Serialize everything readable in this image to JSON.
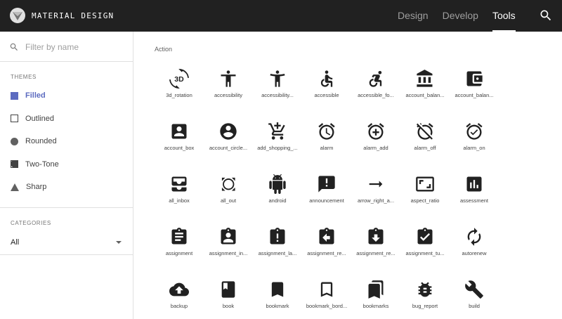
{
  "brand": {
    "name": "MATERIAL DESIGN"
  },
  "nav": {
    "items": [
      {
        "label": "Design"
      },
      {
        "label": "Develop"
      },
      {
        "label": "Tools",
        "active": true
      }
    ]
  },
  "sidebar": {
    "filter_placeholder": "Filter by name",
    "themes_label": "THEMES",
    "themes": [
      {
        "label": "Filled",
        "selected": true
      },
      {
        "label": "Outlined"
      },
      {
        "label": "Rounded"
      },
      {
        "label": "Two-Tone"
      },
      {
        "label": "Sharp"
      }
    ],
    "categories_label": "CATEGORIES",
    "category_value": "All"
  },
  "main": {
    "group_title": "Action",
    "icons": [
      {
        "label": "3d_rotation",
        "icon": "3d-rotation-icon"
      },
      {
        "label": "accessibility",
        "icon": "accessibility-icon"
      },
      {
        "label": "accessibility...",
        "icon": "accessibility-new-icon"
      },
      {
        "label": "accessible",
        "icon": "accessible-icon"
      },
      {
        "label": "accessible_fo...",
        "icon": "accessible-forward-icon"
      },
      {
        "label": "account_balan...",
        "icon": "account-balance-icon"
      },
      {
        "label": "account_balan...",
        "icon": "account-balance-wallet-icon"
      },
      {
        "label": "account_box",
        "icon": "account-box-icon"
      },
      {
        "label": "account_circle...",
        "icon": "account-circle-icon"
      },
      {
        "label": "add_shopping_...",
        "icon": "add-shopping-cart-icon"
      },
      {
        "label": "alarm",
        "icon": "alarm-icon"
      },
      {
        "label": "alarm_add",
        "icon": "alarm-add-icon"
      },
      {
        "label": "alarm_off",
        "icon": "alarm-off-icon"
      },
      {
        "label": "alarm_on",
        "icon": "alarm-on-icon"
      },
      {
        "label": "all_inbox",
        "icon": "all-inbox-icon"
      },
      {
        "label": "all_out",
        "icon": "all-out-icon"
      },
      {
        "label": "android",
        "icon": "android-icon"
      },
      {
        "label": "announcement",
        "icon": "announcement-icon"
      },
      {
        "label": "arrow_right_a...",
        "icon": "arrow-right-alt-icon"
      },
      {
        "label": "aspect_ratio",
        "icon": "aspect-ratio-icon"
      },
      {
        "label": "assessment",
        "icon": "assessment-icon"
      },
      {
        "label": "assignment",
        "icon": "assignment-icon"
      },
      {
        "label": "assignment_in...",
        "icon": "assignment-ind-icon"
      },
      {
        "label": "assignment_la...",
        "icon": "assignment-late-icon"
      },
      {
        "label": "assignment_re...",
        "icon": "assignment-return-icon"
      },
      {
        "label": "assignment_re...",
        "icon": "assignment-returned-icon"
      },
      {
        "label": "assignment_tu...",
        "icon": "assignment-turned-in-icon"
      },
      {
        "label": "autorenew",
        "icon": "autorenew-icon"
      },
      {
        "label": "backup",
        "icon": "backup-icon"
      },
      {
        "label": "book",
        "icon": "book-icon"
      },
      {
        "label": "bookmark",
        "icon": "bookmark-icon"
      },
      {
        "label": "bookmark_bord...",
        "icon": "bookmark-border-icon"
      },
      {
        "label": "bookmarks",
        "icon": "bookmarks-icon"
      },
      {
        "label": "bug_report",
        "icon": "bug-report-icon"
      },
      {
        "label": "build",
        "icon": "build-icon"
      }
    ]
  },
  "colors": {
    "topbar": "#212121",
    "accent": "#5c6bc0",
    "icon": "#212121"
  }
}
